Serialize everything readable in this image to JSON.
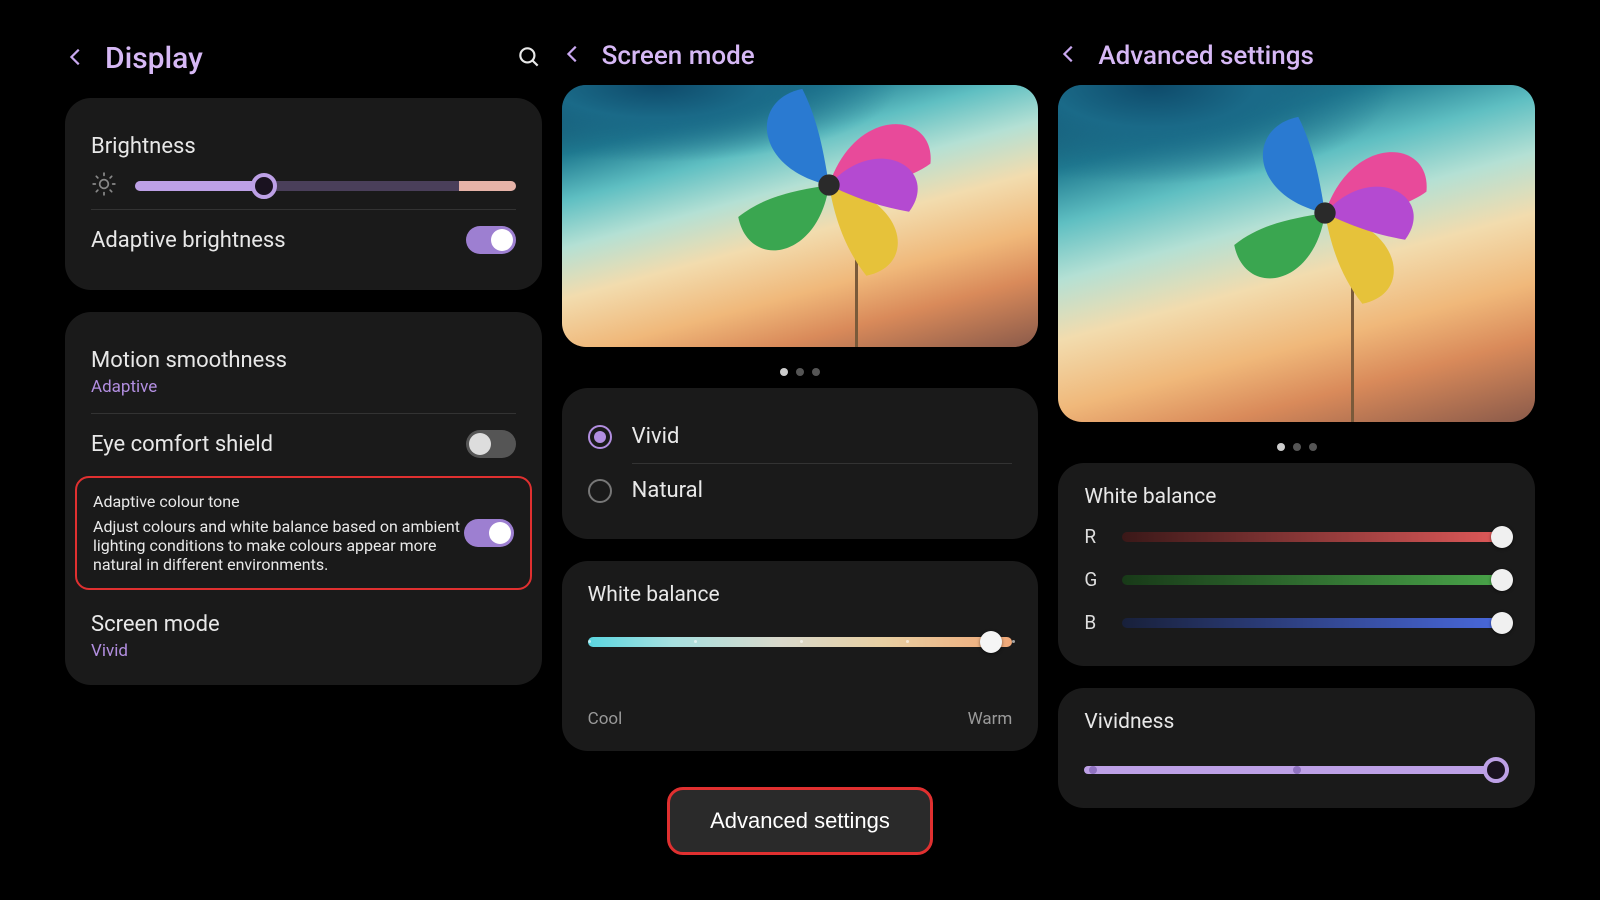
{
  "display": {
    "title": "Display",
    "brightness": {
      "label": "Brightness",
      "value_pct": 34
    },
    "adaptive_brightness": {
      "label": "Adaptive brightness",
      "on": true
    },
    "motion_smoothness": {
      "label": "Motion smoothness",
      "value": "Adaptive"
    },
    "eye_comfort": {
      "label": "Eye comfort shield",
      "on": false
    },
    "adaptive_colour_tone": {
      "label": "Adaptive colour tone",
      "desc": "Adjust colours and white balance based on ambient lighting conditions to make colours appear more natural in different environments.",
      "on": true
    },
    "screen_mode_link": {
      "label": "Screen mode",
      "value": "Vivid"
    }
  },
  "screen_mode": {
    "title": "Screen mode",
    "options": {
      "vivid": "Vivid",
      "natural": "Natural",
      "selected": "vivid"
    },
    "white_balance": {
      "label": "White balance",
      "cool": "Cool",
      "warm": "Warm",
      "value_pct": 95
    },
    "advanced_btn": "Advanced settings"
  },
  "advanced": {
    "title": "Advanced settings",
    "white_balance": {
      "label": "White balance",
      "r_label": "R",
      "g_label": "G",
      "b_label": "B",
      "r": 100,
      "g": 100,
      "b": 100
    },
    "vividness": {
      "label": "Vividness",
      "value_pct": 100
    }
  }
}
